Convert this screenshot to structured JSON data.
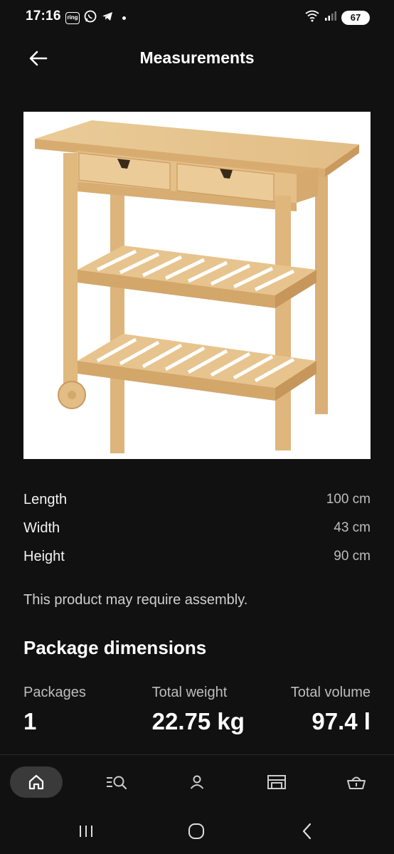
{
  "status_bar": {
    "time": "17:16",
    "ring_label": "ring",
    "battery": "67"
  },
  "header": {
    "title": "Measurements"
  },
  "measurements": [
    {
      "label": "Length",
      "value": "100 cm"
    },
    {
      "label": "Width",
      "value": "43 cm"
    },
    {
      "label": "Height",
      "value": "90 cm"
    }
  ],
  "assembly_note": "This product may require assembly.",
  "package": {
    "title": "Package dimensions",
    "packages_label": "Packages",
    "packages_value": "1",
    "weight_label": "Total weight",
    "weight_value": "22.75 kg",
    "volume_label": "Total volume",
    "volume_value": "97.4 l"
  },
  "bottom_nav": {
    "items": [
      "home-icon",
      "search-list-icon",
      "profile-icon",
      "store-icon",
      "basket-icon"
    ],
    "active": "home"
  },
  "colors": {
    "background": "#111111",
    "image_bg": "#ffffff",
    "wood": "#e6c28c",
    "muted_text": "#bdbdbd",
    "active_nav": "#3a3a3a"
  }
}
